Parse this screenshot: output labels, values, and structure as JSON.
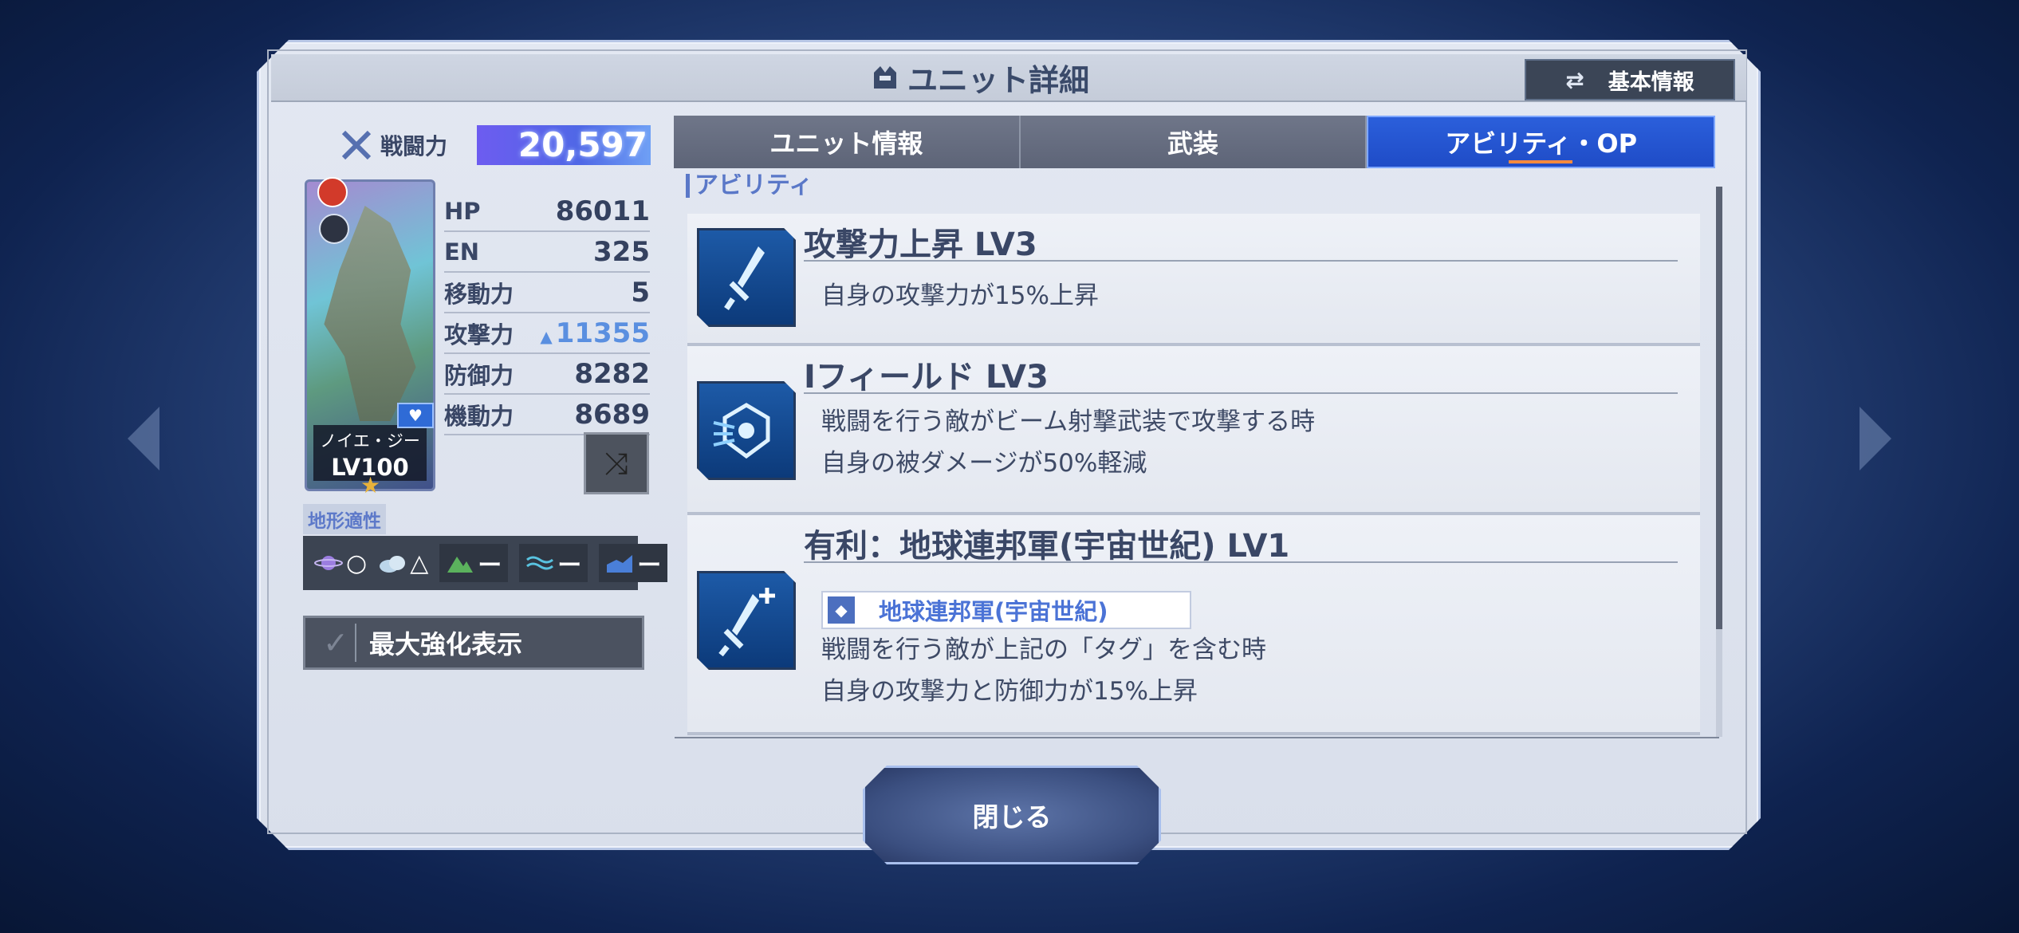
{
  "header": {
    "title": "ユニット詳細",
    "basic_info": "基本情報"
  },
  "power": {
    "label": "戦闘力",
    "value": "20,597"
  },
  "unit": {
    "name": "ノイエ・ジー",
    "level": "LV100"
  },
  "stats": [
    {
      "label": "HP",
      "value": "86011",
      "boosted": false
    },
    {
      "label": "EN",
      "value": "325",
      "boosted": false
    },
    {
      "label": "移動力",
      "value": "5",
      "boosted": false
    },
    {
      "label": "攻撃力",
      "value": "11355",
      "boosted": true
    },
    {
      "label": "防御力",
      "value": "8282",
      "boosted": false
    },
    {
      "label": "機動力",
      "value": "8689",
      "boosted": false
    }
  ],
  "terrain": {
    "label": "地形適性",
    "items": [
      {
        "icon": "space-icon",
        "grade": "○"
      },
      {
        "icon": "air-icon",
        "grade": "△"
      },
      {
        "icon": "land-icon",
        "grade": "ー"
      },
      {
        "icon": "water-icon",
        "grade": "ー"
      },
      {
        "icon": "underwater-icon",
        "grade": "ー"
      }
    ]
  },
  "max_boost": {
    "label": "最大強化表示"
  },
  "tabs": [
    {
      "label": "ユニット情報",
      "active": false
    },
    {
      "label": "武装",
      "active": false
    },
    {
      "label": "アビリティ・OP",
      "active": true
    }
  ],
  "section": {
    "title": "アビリティ"
  },
  "abilities": [
    {
      "name": "攻撃力上昇 LV3",
      "desc1": "自身の攻撃力が15%上昇",
      "desc2": ""
    },
    {
      "name": "Iフィールド LV3",
      "desc1": "戦闘を行う敵がビーム射撃武装で攻撃する時",
      "desc2": "自身の被ダメージが50%軽減"
    },
    {
      "name": "有利：地球連邦軍(宇宙世紀) LV1",
      "tag": "地球連邦軍(宇宙世紀)",
      "desc1": "戦闘を行う敵が上記の「タグ」を含む時",
      "desc2": "自身の攻撃力と防御力が15%上昇"
    }
  ],
  "close": {
    "label": "閉じる"
  },
  "colors": {
    "accent": "#1f4cc7",
    "tab_inactive": "#5d6477",
    "text": "#3a4766"
  }
}
